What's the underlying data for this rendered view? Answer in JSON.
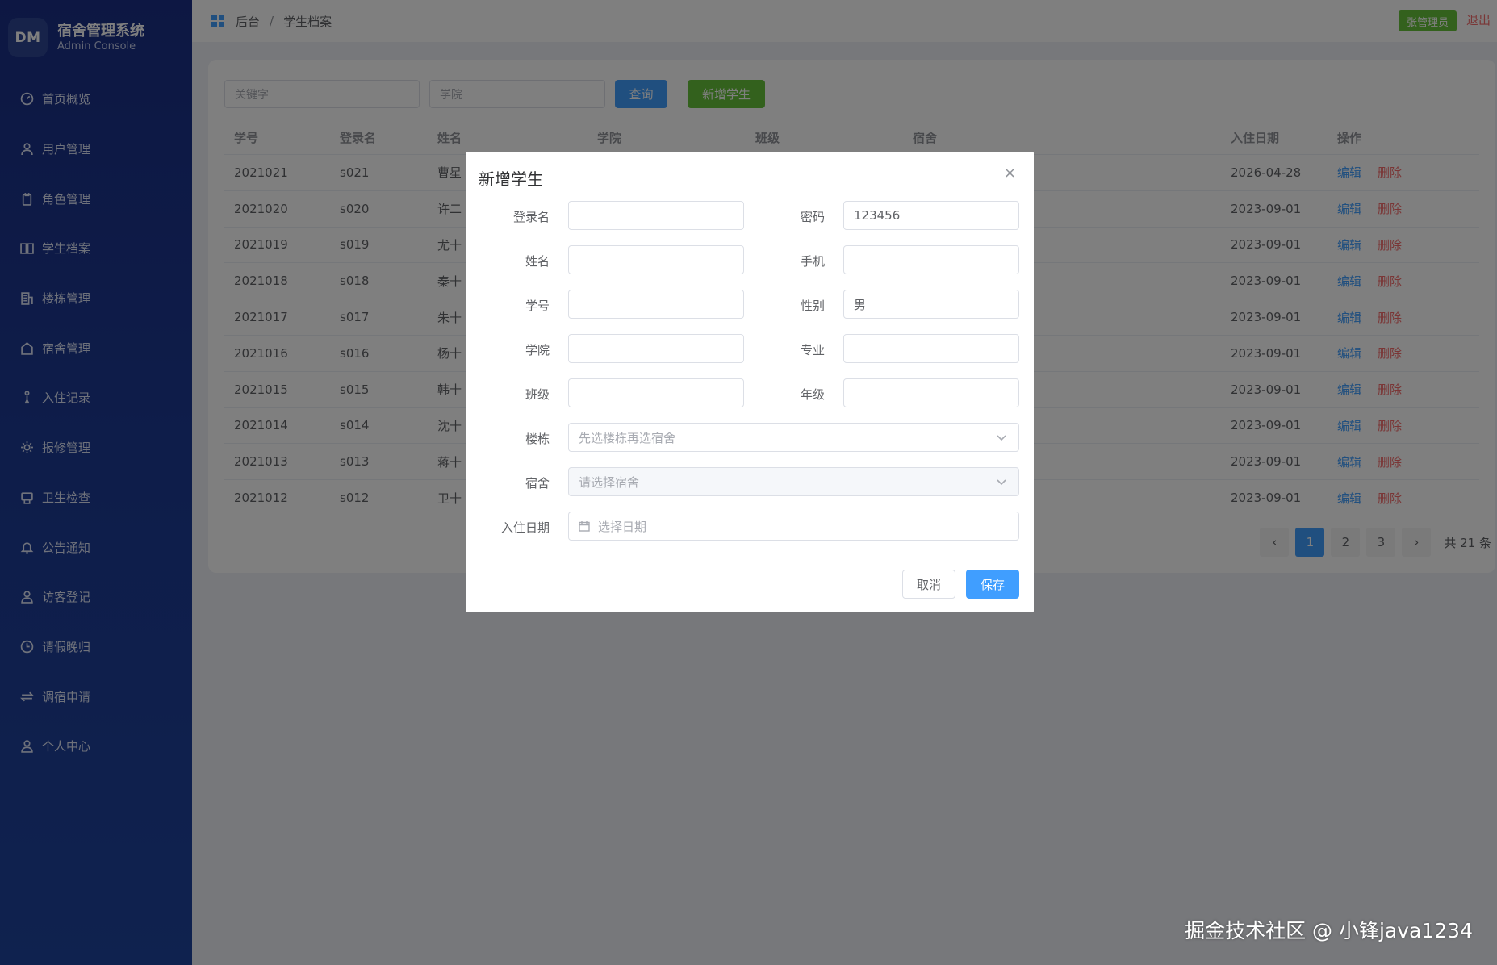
{
  "brand": {
    "logo": "DM",
    "title": "宿舍管理系统",
    "subtitle": "Admin Console"
  },
  "sidebar": {
    "items": [
      {
        "label": "首页概览",
        "icon": "dashboard-icon"
      },
      {
        "label": "用户管理",
        "icon": "user-icon"
      },
      {
        "label": "角色管理",
        "icon": "badge-icon"
      },
      {
        "label": "学生档案",
        "icon": "book-icon"
      },
      {
        "label": "楼栋管理",
        "icon": "building-icon"
      },
      {
        "label": "宿舍管理",
        "icon": "house-icon"
      },
      {
        "label": "入住记录",
        "icon": "person-icon"
      },
      {
        "label": "报修管理",
        "icon": "gear-icon"
      },
      {
        "label": "卫生检查",
        "icon": "clipboard-icon"
      },
      {
        "label": "公告通知",
        "icon": "bell-icon"
      },
      {
        "label": "访客登记",
        "icon": "visitor-icon"
      },
      {
        "label": "请假晚归",
        "icon": "clock-icon"
      },
      {
        "label": "调宿申请",
        "icon": "swap-icon"
      },
      {
        "label": "个人中心",
        "icon": "profile-icon"
      }
    ]
  },
  "header": {
    "breadcrumb": [
      "后台",
      "学生档案"
    ],
    "separator": "/",
    "user": "张管理员",
    "logout": "退出"
  },
  "toolbar": {
    "keyword_placeholder": "关键字",
    "college_placeholder": "学院",
    "search_label": "查询",
    "add_label": "新增学生"
  },
  "table": {
    "columns": [
      "学号",
      "登录名",
      "姓名",
      "学院",
      "班级",
      "宿舍",
      "入住日期",
      "操作"
    ],
    "edit_label": "编辑",
    "delete_label": "删除",
    "rows": [
      {
        "id": "2021021",
        "login": "s021",
        "name": "曹星",
        "date": "2026-04-28"
      },
      {
        "id": "2021020",
        "login": "s020",
        "name": "许二",
        "date": "2023-09-01"
      },
      {
        "id": "2021019",
        "login": "s019",
        "name": "尤十",
        "date": "2023-09-01"
      },
      {
        "id": "2021018",
        "login": "s018",
        "name": "秦十",
        "date": "2023-09-01"
      },
      {
        "id": "2021017",
        "login": "s017",
        "name": "朱十",
        "date": "2023-09-01"
      },
      {
        "id": "2021016",
        "login": "s016",
        "name": "杨十",
        "date": "2023-09-01"
      },
      {
        "id": "2021015",
        "login": "s015",
        "name": "韩十",
        "date": "2023-09-01"
      },
      {
        "id": "2021014",
        "login": "s014",
        "name": "沈十",
        "date": "2023-09-01"
      },
      {
        "id": "2021013",
        "login": "s013",
        "name": "蒋十",
        "date": "2023-09-01"
      },
      {
        "id": "2021012",
        "login": "s012",
        "name": "卫十",
        "date": "2023-09-01"
      }
    ]
  },
  "pagination": {
    "prev": "‹",
    "next": "›",
    "pages": [
      "1",
      "2",
      "3"
    ],
    "current": "1",
    "total": "共 21 条"
  },
  "dialog": {
    "title": "新增学生",
    "close": "×",
    "fields": {
      "login_label": "登录名",
      "login_value": "",
      "password_label": "密码",
      "password_value": "123456",
      "name_label": "姓名",
      "name_value": "",
      "phone_label": "手机",
      "phone_value": "",
      "student_no_label": "学号",
      "student_no_value": "",
      "gender_label": "性别",
      "gender_value": "男",
      "college_label": "学院",
      "college_value": "",
      "major_label": "专业",
      "major_value": "",
      "class_label": "班级",
      "class_value": "",
      "grade_label": "年级",
      "grade_value": "",
      "building_label": "楼栋",
      "building_placeholder": "先选楼栋再选宿舍",
      "room_label": "宿舍",
      "room_placeholder": "请选择宿舍",
      "date_label": "入住日期",
      "date_placeholder": "选择日期"
    },
    "cancel_label": "取消",
    "save_label": "保存"
  },
  "watermark": "掘金技术社区 @ 小锋java1234",
  "colors": {
    "primary": "#409eff",
    "success": "#67c23a",
    "danger": "#f56c6c",
    "sidebar": "#1d3a94"
  }
}
